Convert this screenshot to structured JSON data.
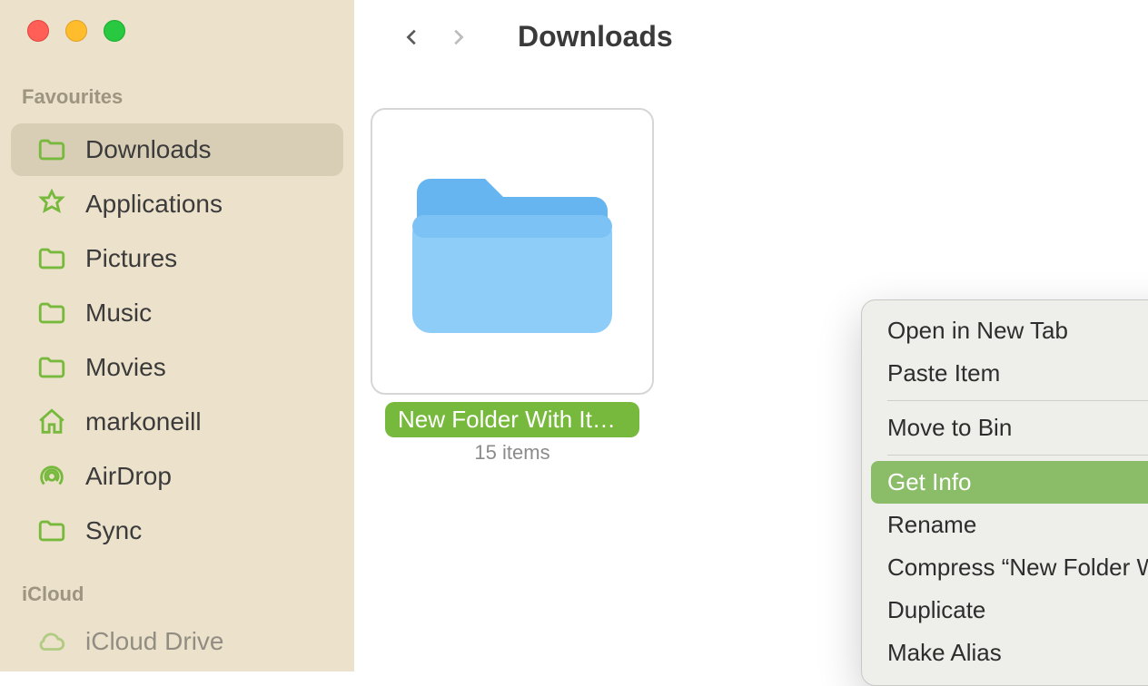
{
  "sidebar": {
    "sections": [
      {
        "header": "Favourites",
        "items": [
          {
            "label": "Downloads",
            "icon": "folder-icon",
            "active": true
          },
          {
            "label": "Applications",
            "icon": "applications-icon",
            "active": false
          },
          {
            "label": "Pictures",
            "icon": "folder-icon",
            "active": false
          },
          {
            "label": "Music",
            "icon": "folder-icon",
            "active": false
          },
          {
            "label": "Movies",
            "icon": "folder-icon",
            "active": false
          },
          {
            "label": "markoneill",
            "icon": "home-icon",
            "active": false
          },
          {
            "label": "AirDrop",
            "icon": "airdrop-icon",
            "active": false
          },
          {
            "label": "Sync",
            "icon": "folder-icon",
            "active": false
          }
        ]
      },
      {
        "header": "iCloud",
        "items": [
          {
            "label": "iCloud Drive",
            "icon": "icloud-icon",
            "active": false
          }
        ]
      }
    ]
  },
  "toolbar": {
    "location": "Downloads"
  },
  "content": {
    "items": [
      {
        "name": "New Folder With Items",
        "subtitle": "15 items",
        "selected": true
      }
    ]
  },
  "context_menu": {
    "items": [
      {
        "label": "Open in New Tab",
        "type": "item"
      },
      {
        "label": "Paste Item",
        "type": "item"
      },
      {
        "type": "sep"
      },
      {
        "label": "Move to Bin",
        "type": "item"
      },
      {
        "type": "sep"
      },
      {
        "label": "Get Info",
        "type": "item",
        "highlight": true
      },
      {
        "label": "Rename",
        "type": "item"
      },
      {
        "label": "Compress “New Folder With Items”",
        "type": "item"
      },
      {
        "label": "Duplicate",
        "type": "item"
      },
      {
        "label": "Make Alias",
        "type": "item"
      }
    ]
  }
}
